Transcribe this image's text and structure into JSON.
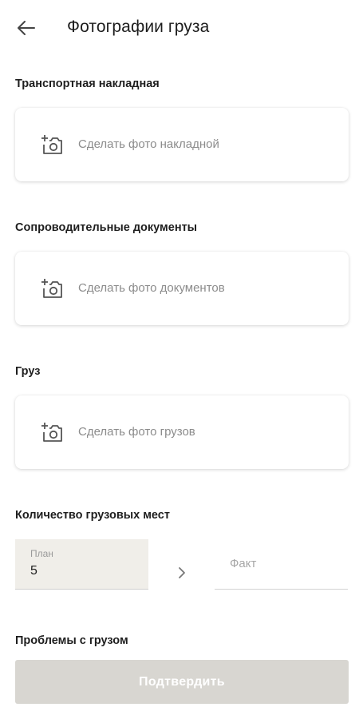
{
  "header": {
    "title": "Фотографии груза",
    "back_icon": "arrow-left-icon"
  },
  "sections": {
    "waybill": {
      "label": "Транспортная накладная",
      "action": "Сделать фото накладной",
      "icon": "add-photo-icon"
    },
    "documents": {
      "label": "Сопроводительные документы",
      "action": "Сделать фото документов",
      "icon": "add-photo-icon"
    },
    "cargo": {
      "label": "Груз",
      "action": "Сделать фото грузов",
      "icon": "add-photo-icon"
    }
  },
  "places": {
    "label": "Количество грузовых мест",
    "plan_label": "План",
    "plan_value": "5",
    "fact_placeholder": "Факт",
    "arrow_icon": "chevron-right-icon"
  },
  "problems": {
    "label": "Проблемы с грузом"
  },
  "footer": {
    "confirm_label": "Подтвердить"
  },
  "colors": {
    "plan_background": "#f0eee9",
    "confirm_disabled": "#d8d6d1",
    "placeholder_text": "#8c8c8c"
  }
}
